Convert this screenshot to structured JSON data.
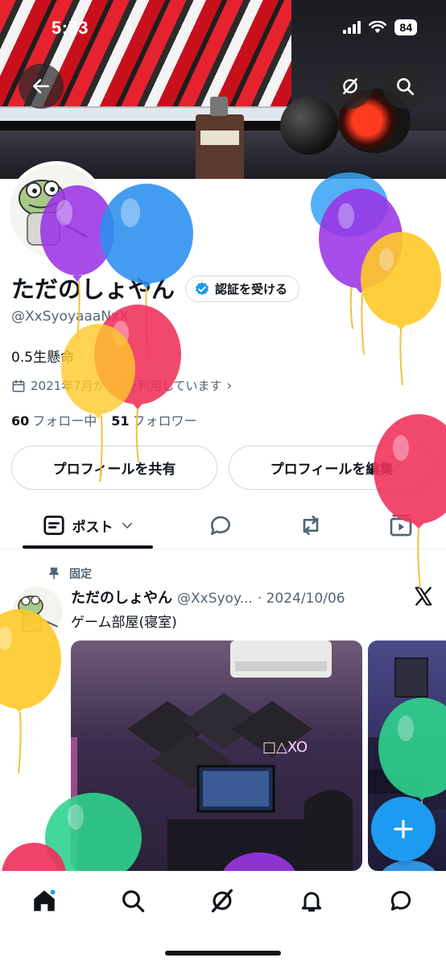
{
  "status_bar": {
    "time": "5:53",
    "battery": "84"
  },
  "profile": {
    "display_name": "ただのしょやん",
    "verify_button": "認証を受ける",
    "handle": "@XxSyoyaaaNxX",
    "bio": "0.5生懸命",
    "joined": "2021年7月からXを利用しています",
    "following_count": "60",
    "following_label": "フォロー中",
    "followers_count": "51",
    "followers_label": "フォロワー",
    "share_button": "プロフィールを共有",
    "edit_button": "プロフィールを編集"
  },
  "tabs": {
    "posts_label": "ポスト",
    "icons": [
      "posts-icon",
      "replies-icon",
      "reposts-icon",
      "media-icon"
    ]
  },
  "post": {
    "pinned_label": "固定",
    "author_name": "ただのしょやん",
    "author_handle": "@XxSyoy...",
    "date": "· 2024/10/06",
    "text": "ゲーム部屋(寝室)"
  },
  "bottom_nav": [
    "home-icon",
    "search-icon",
    "grok-icon",
    "notifications-icon",
    "messages-icon"
  ],
  "colors": {
    "accent": "#1d9bf0",
    "text_primary": "#0f1419",
    "text_secondary": "#536471",
    "border": "#cfd9de"
  }
}
